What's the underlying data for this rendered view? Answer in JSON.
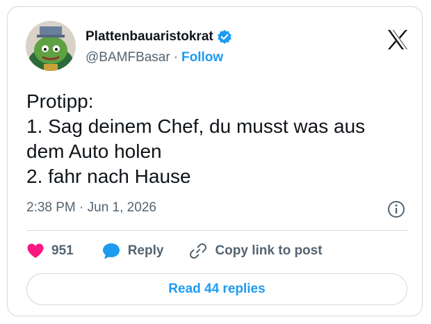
{
  "author": {
    "display_name": "Plattenbauaristokrat",
    "handle": "@BAMFBasar",
    "separator": "·",
    "follow_label": "Follow",
    "verified": true
  },
  "tweet": {
    "lines": [
      "Protipp:",
      "1. Sag deinem Chef, du musst was aus",
      "dem Auto holen",
      "2. fahr nach Hause"
    ],
    "timestamp": "2:38 PM · Jun 1, 2026"
  },
  "actions": {
    "likes_count": "951",
    "reply_label": "Reply",
    "copy_link_label": "Copy link to post"
  },
  "read_replies_label": "Read 44 replies",
  "icons": {
    "logo": "x-logo-icon",
    "verified": "verified-badge-icon",
    "info": "info-icon",
    "like": "heart-icon",
    "reply": "speech-bubble-icon",
    "copy": "link-icon"
  },
  "colors": {
    "accent": "#1d9bf0",
    "heart": "#f91880",
    "text": "#0f1419",
    "muted": "#536471",
    "border": "#cfd9de"
  }
}
